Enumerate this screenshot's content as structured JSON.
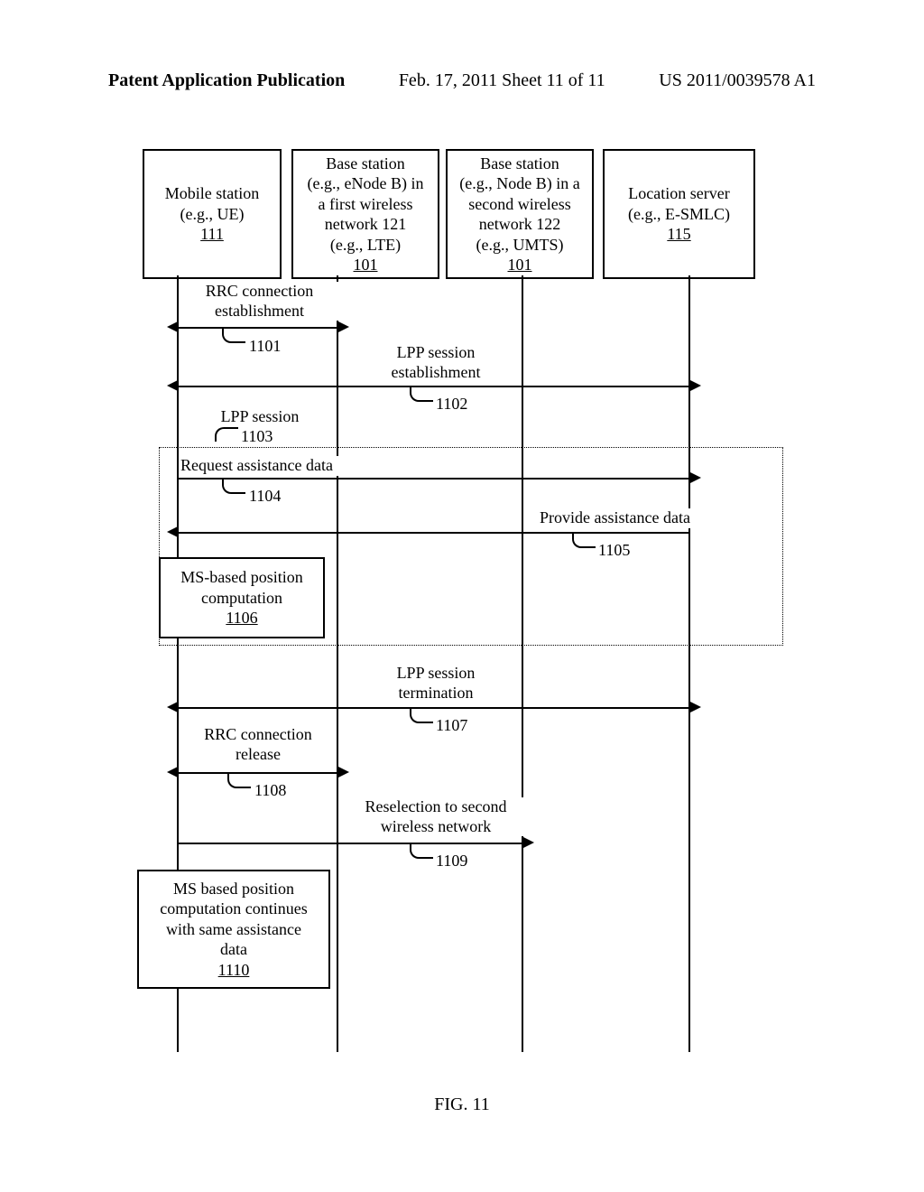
{
  "header": {
    "left": "Patent Application Publication",
    "middle": "Feb. 17, 2011  Sheet 11 of 11",
    "right": "US 2011/0039578 A1"
  },
  "heads": {
    "ms": {
      "l1": "Mobile station",
      "l2": "(e.g., UE)",
      "ref": "111"
    },
    "bs1": {
      "l1": "Base station",
      "l2": "(e.g., eNode B) in",
      "l3": "a first wireless",
      "l4": "network 121",
      "l5": "(e.g., LTE)",
      "ref": "101"
    },
    "bs2": {
      "l1": "Base station",
      "l2": "(e.g., Node B) in a",
      "l3": "second wireless",
      "l4": "network 122",
      "l5": "(e.g., UMTS)",
      "ref": "101"
    },
    "ls": {
      "l1": "Location server",
      "l2": "(e.g., E-SMLC)",
      "ref": "115"
    }
  },
  "labels": {
    "rrc_est": "RRC connection\nestablishment",
    "lpp_est": "LPP session\nestablishment",
    "lpp_sess": "LPP session",
    "req_ad": "Request assistance data",
    "prov_ad": "Provide assistance data",
    "ms_pos": {
      "l1": "MS-based position",
      "l2": "computation",
      "ref": "1106"
    },
    "lpp_term": "LPP session\ntermination",
    "rrc_rel": "RRC connection\nrelease",
    "resel": "Reselection to second\nwireless network",
    "ms_cont": {
      "l1": "MS based position",
      "l2": "computation continues",
      "l3": "with same assistance",
      "l4": "data",
      "ref": "1110"
    }
  },
  "refs": {
    "r1101": "1101",
    "r1102": "1102",
    "r1103": "1103",
    "r1104": "1104",
    "r1105": "1105",
    "r1107": "1107",
    "r1108": "1108",
    "r1109": "1109"
  },
  "figcap": "FIG. 11"
}
